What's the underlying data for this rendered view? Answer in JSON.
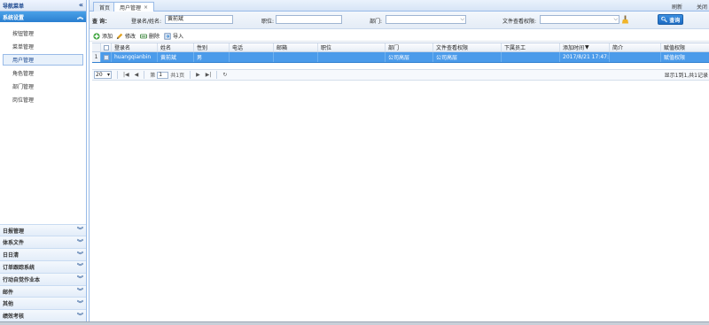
{
  "nav": {
    "title": "导航菜单",
    "active_section": "系统设置",
    "items": [
      {
        "label": "按钮管理",
        "selected": false
      },
      {
        "label": "菜单管理",
        "selected": false
      },
      {
        "label": "用户管理",
        "selected": true
      },
      {
        "label": "角色管理",
        "selected": false
      },
      {
        "label": "部门管理",
        "selected": false
      },
      {
        "label": "岗位管理",
        "selected": false
      }
    ],
    "groups": [
      "日报管理",
      "体系文件",
      "日日清",
      "订单跟踪系统",
      "行动自觉作业本",
      "邮件",
      "其他",
      "绩效考核"
    ]
  },
  "tabs": {
    "home": "首页",
    "active": "用户管理",
    "refresh": "刷新",
    "close": "关闭"
  },
  "search": {
    "query_label": "查 询：",
    "login_label": "登录名/姓名:",
    "login_value": "黄前斌",
    "position_label": "职位:",
    "position_value": "",
    "dept_label": "部门:",
    "dept_value": "",
    "perm_label": "文件查看权限:",
    "perm_value": "",
    "search_button": "查询"
  },
  "toolbar": {
    "add": "添加",
    "edit": "修改",
    "delete": "删除",
    "import": "导入"
  },
  "grid": {
    "headers": [
      "登录名",
      "姓名",
      "性别",
      "电话",
      "邮箱",
      "职位",
      "部门",
      "文件查看权限",
      "下属员工",
      "添加时间",
      "简介",
      "赋值权限"
    ],
    "sort_indicator": "▼",
    "rows": [
      {
        "num": "1",
        "cells": [
          "huangqianbin",
          "黄前斌",
          "男",
          "",
          "",
          "",
          "公司高层",
          "公司高层",
          "",
          "2017/8/21 17:47:3",
          "",
          "赋值权限"
        ]
      }
    ]
  },
  "pager": {
    "page_size": "20",
    "page_label_pre": "第",
    "page_value": "1",
    "page_label_post": "共1页",
    "info": "显示1到1,共1记录"
  },
  "colors": {
    "accent": "#2a7fd0",
    "selected_row": "#4b9bea",
    "border": "#99bbe8"
  }
}
